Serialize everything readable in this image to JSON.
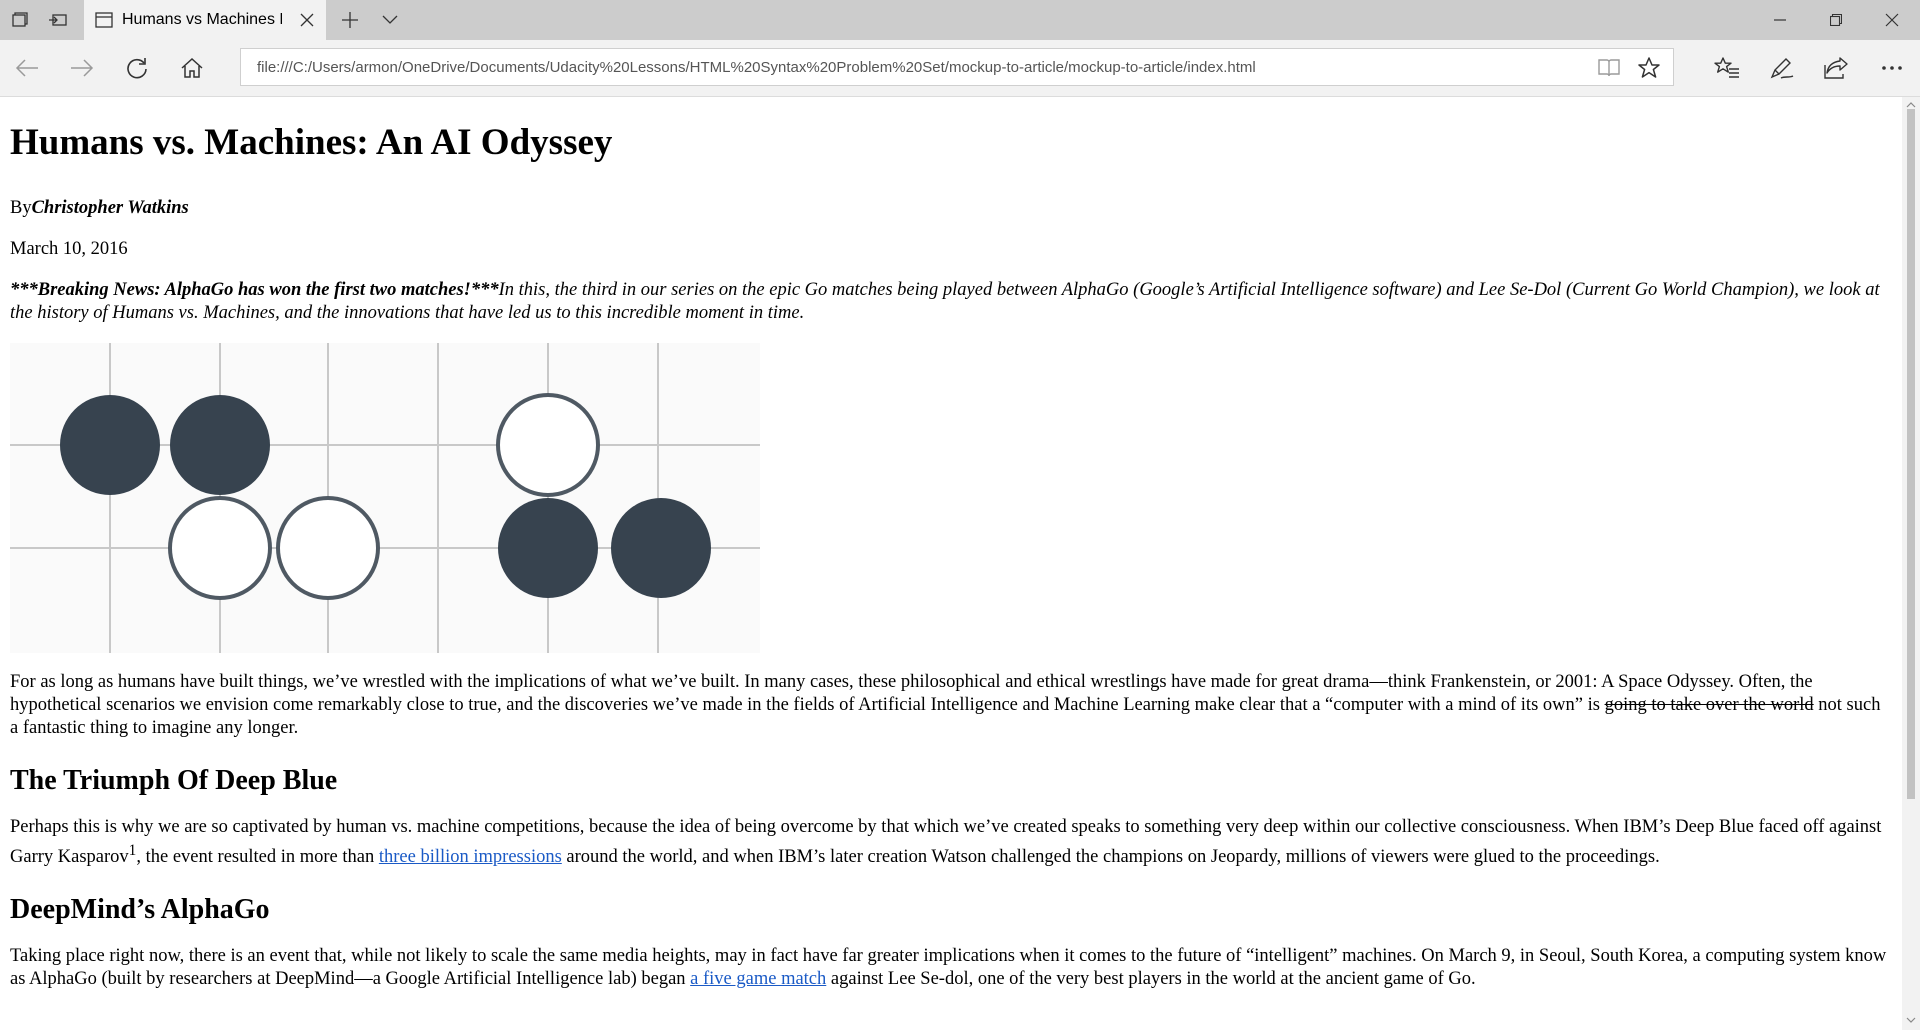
{
  "browser": {
    "tab_title": "Humans vs Machines Bl",
    "address": "file:///C:/Users/armon/OneDrive/Documents/Udacity%20Lessons/HTML%20Syntax%20Problem%20Set/mockup-to-article/mockup-to-article/index.html",
    "icons": {
      "tab_preview": "tabs-aside-icon",
      "tab_restore": "set-aside-tabs-icon",
      "back": "back-arrow-icon",
      "forward": "forward-arrow-icon",
      "refresh": "refresh-icon",
      "home": "home-icon",
      "reading_view": "reading-view-icon",
      "favorite": "star-icon",
      "hub": "favorites-hub-icon",
      "notes": "pen-icon",
      "share": "share-icon",
      "more": "more-icon"
    }
  },
  "article": {
    "title": "Humans vs. Machines: An AI Odyssey",
    "byline_prefix": "By",
    "author": "Christopher Watkins",
    "date": "March 10, 2016",
    "breaking": "***Breaking News: AlphaGo has won the first two matches!***",
    "intro": "In this, the third in our series on the epic Go matches being played between AlphaGo (Google’s Artificial Intelligence software) and Lee Se-Dol (Current Go World Champion), we look at the history of Humans vs. Machines, and the innovations that have led us to this incredible moment in time.",
    "p1_a": "For as long as humans have built things, we’ve wrestled with the implications of what we’ve built. In many cases, these philosophical and ethical wrestlings have made for great drama—think Frankenstein, or 2001: A Space Odyssey. Often, the hypothetical scenarios we envision come remarkably close to true, and the discoveries we’ve made in the fields of Artificial Intelligence and Machine Learning make clear that a “computer with a mind of its own” is ",
    "p1_strike": "going to take over the world",
    "p1_b": " not such a fantastic thing to imagine any longer.",
    "h2_1": "The Triumph Of Deep Blue",
    "p2_a": "Perhaps this is why we are so captivated by human vs. machine competitions, because the idea of being overcome by that which we’ve created speaks to something very deep within our collective consciousness. When IBM’s Deep Blue faced off against Garry Kasparov",
    "p2_sup": "1",
    "p2_b": ", the event resulted in more than ",
    "p2_link": "three billion impressions",
    "p2_c": " around the world, and when IBM’s later creation Watson challenged the champions on Jeopardy, millions of viewers were glued to the proceedings.",
    "h2_2": "DeepMind’s AlphaGo",
    "p3_a": "Taking place right now, there is an event that, while not likely to scale the same media heights, may in fact have far greater implications when it comes to the future of “intelligent” machines. On March 9, in Seoul, South Korea, a computing system know as AlphaGo (built by researchers at DeepMind—a Google Artificial Intelligence lab) began ",
    "p3_link": "a five game match",
    "p3_b": " against Lee Se-dol, one of the very best players in the world at the ancient game of Go."
  },
  "colors": {
    "stone_dark": "#37434f",
    "stone_outline": "#4f5963",
    "grid_line": "#c8c8c8",
    "link": "#1a5ac6"
  }
}
